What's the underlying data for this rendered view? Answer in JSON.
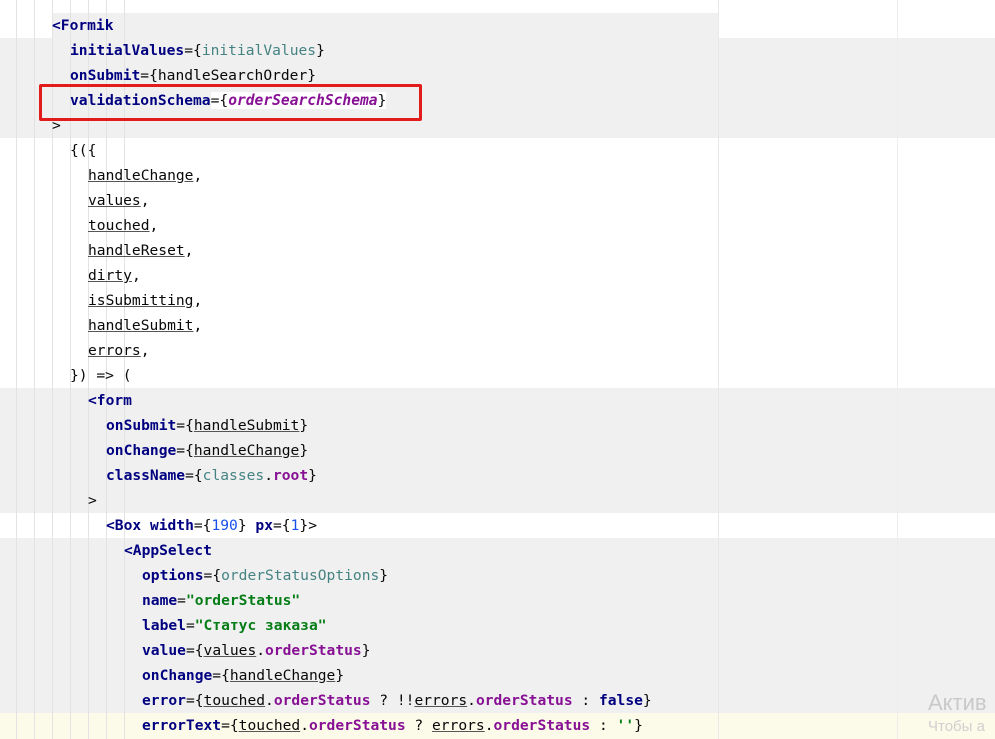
{
  "editor": {
    "lines": [
      [
        [
          "tag",
          "<Formik"
        ]
      ],
      [
        [
          "attr",
          "initialValues"
        ],
        [
          "plain",
          "="
        ],
        [
          "brace",
          "{"
        ],
        [
          "field",
          "initialValues"
        ],
        [
          "brace",
          "}"
        ]
      ],
      [
        [
          "attr",
          "onSubmit"
        ],
        [
          "plain",
          "="
        ],
        [
          "brace",
          "{"
        ],
        [
          "plain",
          "handleSearchOrder"
        ],
        [
          "brace",
          "}"
        ]
      ],
      [
        [
          "attr",
          "validationSchema"
        ],
        [
          "plain",
          "="
        ],
        [
          "brace",
          "{"
        ],
        [
          "italicVar",
          "orderSearchSchema"
        ],
        [
          "brace",
          "}"
        ]
      ],
      [
        [
          "plain",
          ">"
        ]
      ],
      [
        [
          "plain",
          "{({"
        ]
      ],
      [
        [
          "param",
          "handleChange"
        ],
        [
          "plain",
          ","
        ]
      ],
      [
        [
          "param",
          "values"
        ],
        [
          "plain",
          ","
        ]
      ],
      [
        [
          "param",
          "touched"
        ],
        [
          "plain",
          ","
        ]
      ],
      [
        [
          "param",
          "handleReset"
        ],
        [
          "plain",
          ","
        ]
      ],
      [
        [
          "param",
          "dirty"
        ],
        [
          "plain",
          ","
        ]
      ],
      [
        [
          "param",
          "isSubmitting"
        ],
        [
          "plain",
          ","
        ]
      ],
      [
        [
          "param",
          "handleSubmit"
        ],
        [
          "plain",
          ","
        ]
      ],
      [
        [
          "param",
          "errors"
        ],
        [
          "plain",
          ","
        ]
      ],
      [
        [
          "plain",
          "}) => ("
        ]
      ],
      [
        [
          "tag",
          "<form"
        ]
      ],
      [
        [
          "attr",
          "onSubmit"
        ],
        [
          "plain",
          "="
        ],
        [
          "brace",
          "{"
        ],
        [
          "param",
          "handleSubmit"
        ],
        [
          "brace",
          "}"
        ]
      ],
      [
        [
          "attr",
          "onChange"
        ],
        [
          "plain",
          "="
        ],
        [
          "brace",
          "{"
        ],
        [
          "param",
          "handleChange"
        ],
        [
          "brace",
          "}"
        ]
      ],
      [
        [
          "attr",
          "className"
        ],
        [
          "plain",
          "="
        ],
        [
          "brace",
          "{"
        ],
        [
          "field",
          "classes"
        ],
        [
          "plain",
          "."
        ],
        [
          "prop",
          "root"
        ],
        [
          "brace",
          "}"
        ]
      ],
      [
        [
          "plain",
          ">"
        ]
      ],
      [
        [
          "tag",
          "<Box "
        ],
        [
          "attr",
          "width"
        ],
        [
          "plain",
          "="
        ],
        [
          "brace",
          "{"
        ],
        [
          "num",
          "190"
        ],
        [
          "brace",
          "}"
        ],
        [
          "plain",
          " "
        ],
        [
          "attr",
          "px"
        ],
        [
          "plain",
          "="
        ],
        [
          "brace",
          "{"
        ],
        [
          "num",
          "1"
        ],
        [
          "brace",
          "}"
        ],
        [
          "plain",
          ">"
        ]
      ],
      [
        [
          "tag",
          "<AppSelect"
        ]
      ],
      [
        [
          "attr",
          "options"
        ],
        [
          "plain",
          "="
        ],
        [
          "brace",
          "{"
        ],
        [
          "field",
          "orderStatusOptions"
        ],
        [
          "brace",
          "}"
        ]
      ],
      [
        [
          "attr",
          "name"
        ],
        [
          "plain",
          "="
        ],
        [
          "str",
          "\"orderStatus\""
        ]
      ],
      [
        [
          "attr",
          "label"
        ],
        [
          "plain",
          "="
        ],
        [
          "str",
          "\"Статус заказа\""
        ]
      ],
      [
        [
          "attr",
          "value"
        ],
        [
          "plain",
          "="
        ],
        [
          "brace",
          "{"
        ],
        [
          "param",
          "values"
        ],
        [
          "plain",
          "."
        ],
        [
          "prop",
          "orderStatus"
        ],
        [
          "brace",
          "}"
        ]
      ],
      [
        [
          "attr",
          "onChange"
        ],
        [
          "plain",
          "="
        ],
        [
          "brace",
          "{"
        ],
        [
          "param",
          "handleChange"
        ],
        [
          "brace",
          "}"
        ]
      ],
      [
        [
          "attr",
          "error"
        ],
        [
          "plain",
          "="
        ],
        [
          "brace",
          "{"
        ],
        [
          "param",
          "touched"
        ],
        [
          "plain",
          "."
        ],
        [
          "prop",
          "orderStatus"
        ],
        [
          "plain",
          " ? !!"
        ],
        [
          "param",
          "errors"
        ],
        [
          "plain",
          "."
        ],
        [
          "prop",
          "orderStatus"
        ],
        [
          "plain",
          " : "
        ],
        [
          "kw",
          "false"
        ],
        [
          "brace",
          "}"
        ]
      ],
      [
        [
          "attr",
          "errorText"
        ],
        [
          "plain",
          "="
        ],
        [
          "brace",
          "{"
        ],
        [
          "param",
          "touched"
        ],
        [
          "plain",
          "."
        ],
        [
          "prop",
          "orderStatus"
        ],
        [
          "plain",
          " ? "
        ],
        [
          "param",
          "errors"
        ],
        [
          "plain",
          "."
        ],
        [
          "prop",
          "orderStatus"
        ],
        [
          "plain",
          " : "
        ],
        [
          "str",
          "''"
        ],
        [
          "brace",
          "}"
        ]
      ]
    ]
  },
  "watermark": {
    "line1": "Актив",
    "line2": "Чтобы а"
  }
}
